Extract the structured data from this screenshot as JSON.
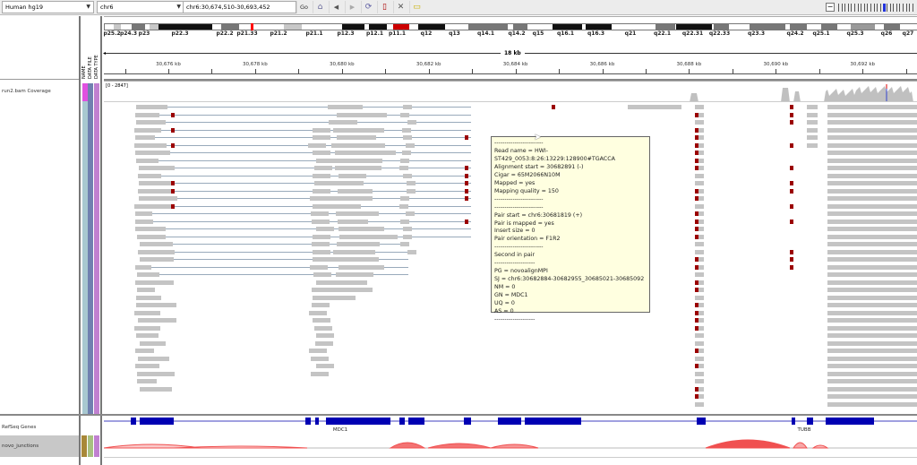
{
  "toolbar": {
    "genome": "Human hg19",
    "chromosome": "chr6",
    "locus": "chr6:30,674,510-30,693,452",
    "go_label": "Go",
    "icons": [
      "home-icon",
      "back-icon",
      "forward-icon",
      "refresh-icon",
      "region-of-interest-icon",
      "resize-icon",
      "popup-text-icon"
    ],
    "zoom_level_fraction": 0.63
  },
  "ideogram": {
    "bands": [
      {
        "label": "p25.2",
        "stain": "gpos25"
      },
      {
        "label": "p24.3",
        "stain": "gpos75"
      },
      {
        "label": "p23",
        "stain": "gpos25"
      },
      {
        "label": "p22.3",
        "stain": "gpos100"
      },
      {
        "label": "p22.2",
        "stain": "gpos75"
      },
      {
        "label": "p21.33",
        "stain": "gneg"
      },
      {
        "label": "p21.2",
        "stain": "gpos25"
      },
      {
        "label": "p21.1",
        "stain": "gneg"
      },
      {
        "label": "p12.3",
        "stain": "gpos100"
      },
      {
        "label": "p12.1",
        "stain": "gpos100"
      },
      {
        "label": "p11.1",
        "stain": "acen"
      },
      {
        "label": "q12",
        "stain": "gpos100"
      },
      {
        "label": "q13",
        "stain": "gneg"
      },
      {
        "label": "q14.1",
        "stain": "gpos75"
      },
      {
        "label": "q14.2",
        "stain": "gpos75"
      },
      {
        "label": "q15",
        "stain": "gneg"
      },
      {
        "label": "q16.1",
        "stain": "gpos100"
      },
      {
        "label": "q16.3",
        "stain": "gpos100"
      },
      {
        "label": "q21",
        "stain": "gneg"
      },
      {
        "label": "q22.1",
        "stain": "gpos75"
      },
      {
        "label": "q22.31",
        "stain": "gpos100"
      },
      {
        "label": "q22.33",
        "stain": "gpos75"
      },
      {
        "label": "q23.3",
        "stain": "gpos75"
      },
      {
        "label": "q24.2",
        "stain": "gpos75"
      },
      {
        "label": "q25.1",
        "stain": "gpos75"
      },
      {
        "label": "q25.3",
        "stain": "gpos50"
      },
      {
        "label": "q26",
        "stain": "gpos75"
      },
      {
        "label": "q27",
        "stain": "gneg"
      }
    ],
    "current_region_color": "#ff0000"
  },
  "ruler": {
    "span_label": "18 kb",
    "ticks": [
      "30,676 kb",
      "30,678 kb",
      "30,680 kb",
      "30,682 kb",
      "30,684 kb",
      "30,686 kb",
      "30,688 kb",
      "30,690 kb",
      "30,692 kb"
    ]
  },
  "attribute_headers": [
    "NAME",
    "DATA FILE",
    "DATA TYPE"
  ],
  "tracks": {
    "coverage": {
      "name": "run2.bam Coverage",
      "range": "[0 - 2847]"
    },
    "refseq": {
      "name": "RefSeq Genes",
      "genes": [
        "MDC1",
        "TUBB"
      ],
      "color": "#0000b3"
    },
    "junctions": {
      "name": "novo_junctions",
      "color": "#f05050"
    }
  },
  "tooltip": {
    "lines": [
      "------------------------",
      "Read name = HWI-ST429_0053:8:26:13229:128900#TGACCA",
      "Alignment start = 30682891 (-)",
      "Cigar = 65M2066N10M",
      "Mapped = yes",
      "Mapping quality = 150",
      "------------------------",
      "------------------------",
      "Pair start = chr6:30681819 (+)",
      "Pair is mapped = yes",
      "Insert size = 0",
      "Pair orientation = F1R2",
      "------------------------",
      "Second in pair",
      "--------------------",
      "PG = novoalignMPI",
      "SJ = chr6:30682884-30682955_30685021-30685092",
      "NM = 0",
      "GN = MDC1",
      "UQ = 0",
      "AS = 0",
      "--------------------"
    ]
  },
  "colors": {
    "read": "#c4c4c4",
    "mismatch": "#9b0000",
    "coverage": "#c0c0c0"
  }
}
